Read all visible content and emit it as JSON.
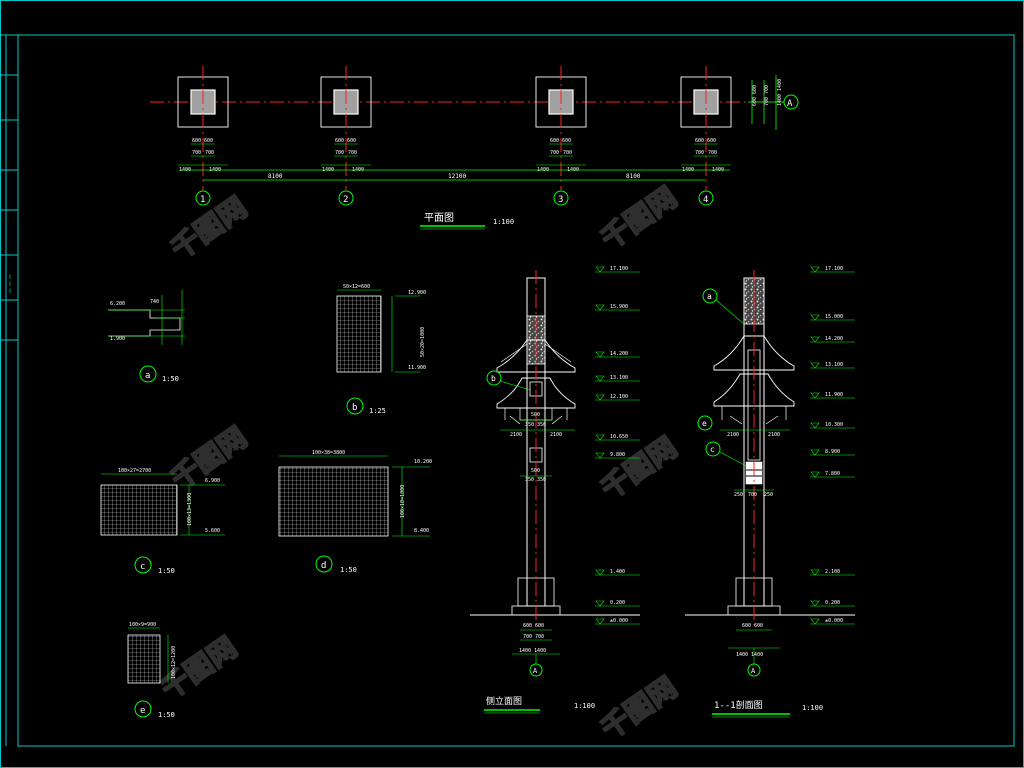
{
  "colors": {
    "background": "#000000",
    "frame": "#00c8c8",
    "outline": "#ffffff",
    "axis": "#ff2020",
    "dimension": "#00ff00",
    "text": "#ffffff",
    "fill": "#a0a0a0",
    "hatch": "#dddddd",
    "watermark": "#2a2a2a"
  },
  "plan": {
    "title": "平面图",
    "scale": "1:100",
    "axis_labels": [
      "1",
      "2",
      "3",
      "4"
    ],
    "row_label": "A",
    "column_dim": "600 600",
    "column_sub_dims": [
      "700",
      "700"
    ],
    "column_outer_dims": [
      "1400",
      "1400"
    ],
    "spans": [
      "8100",
      "12100",
      "8100"
    ],
    "right_dims": [
      "600 600",
      "700 700",
      "1400 1400"
    ]
  },
  "details": {
    "a": {
      "label": "a",
      "scale": "1:50",
      "dims": [
        "6.200",
        "1.900",
        "740"
      ]
    },
    "b": {
      "label": "b",
      "scale": "1:25",
      "top_dim": "50×12=600",
      "side_dim": "50×20=1000",
      "elev_top": "12.900",
      "elev_bottom": "11.900"
    },
    "c": {
      "label": "c",
      "scale": "1:50",
      "top_dim": "100×27=2700",
      "side_dim": "100×13=1300",
      "elev_top": "6.900",
      "elev_bottom": "5.600"
    },
    "d": {
      "label": "d",
      "scale": "1:50",
      "top_dim": "100×38=3800",
      "side_dim": "100×18=1800",
      "elev_top": "10.200",
      "elev_bottom": "8.400"
    },
    "e": {
      "label": "e",
      "scale": "1:50",
      "top_dim": "100×9=900",
      "side_dim": "100×12=1200"
    }
  },
  "side_elevation": {
    "title": "侧立面图",
    "scale": "1:100",
    "callout": "b",
    "levels": [
      "17.100",
      "15.900",
      "14.200",
      "13.100",
      "12.100",
      "10.650",
      "9.800",
      "1.400",
      "0.200",
      "±0.000"
    ],
    "dims": [
      "2100",
      "2100",
      "500",
      "350 350",
      "500",
      "350 350"
    ],
    "base_dims": [
      "600 600",
      "700 700",
      "1400 1400"
    ],
    "row_label": "A"
  },
  "section": {
    "title": "1--1剖面图",
    "scale": "1:100",
    "callouts": [
      "a",
      "e",
      "c"
    ],
    "levels": [
      "17.100",
      "15.000",
      "14.200",
      "13.100",
      "11.900",
      "10.300",
      "8.900",
      "7.800",
      "2.100",
      "0.200",
      "±0.000"
    ],
    "dims": [
      "2100",
      "2100",
      "250",
      "700",
      "250"
    ],
    "base_dims": [
      "600 600",
      "1400 1400"
    ],
    "row_label": "A"
  },
  "watermark": "千图网"
}
